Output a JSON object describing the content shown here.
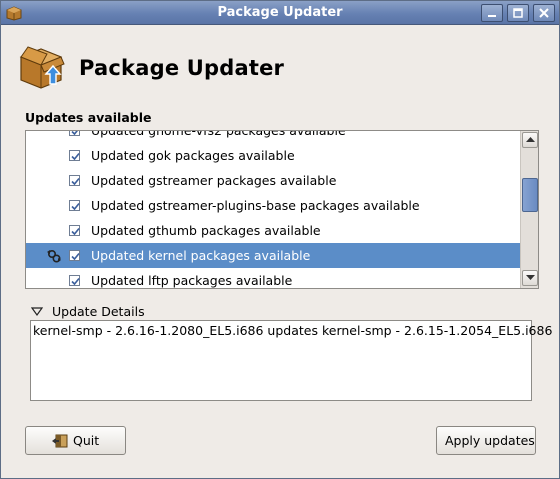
{
  "window": {
    "title": "Package Updater"
  },
  "header": {
    "title": "Package Updater"
  },
  "updates": {
    "label": "Updates available",
    "partial_row_label": "Updated gnome-vfs2 packages available",
    "items": [
      {
        "label": "Updated gok packages available",
        "checked": true,
        "selected": false
      },
      {
        "label": "Updated gstreamer packages available",
        "checked": true,
        "selected": false
      },
      {
        "label": "Updated gstreamer-plugins-base packages available",
        "checked": true,
        "selected": false
      },
      {
        "label": "Updated gthumb packages available",
        "checked": true,
        "selected": false
      },
      {
        "label": "Updated kernel packages available",
        "checked": true,
        "selected": true,
        "status_icon": "update-cycle-icon"
      },
      {
        "label": "Updated lftp packages available",
        "checked": true,
        "selected": false
      }
    ]
  },
  "details": {
    "expander_label": "Update Details",
    "expanded": true,
    "text": "kernel-smp - 2.6.16-1.2080_EL5.i686 updates kernel-smp - 2.6.15-1.2054_EL5.i686"
  },
  "buttons": {
    "quit": "Quit",
    "apply": "Apply updates"
  },
  "colors": {
    "selection": "#5b8dc8",
    "titlebar": "#6681b3",
    "window_bg": "#efebe7"
  }
}
